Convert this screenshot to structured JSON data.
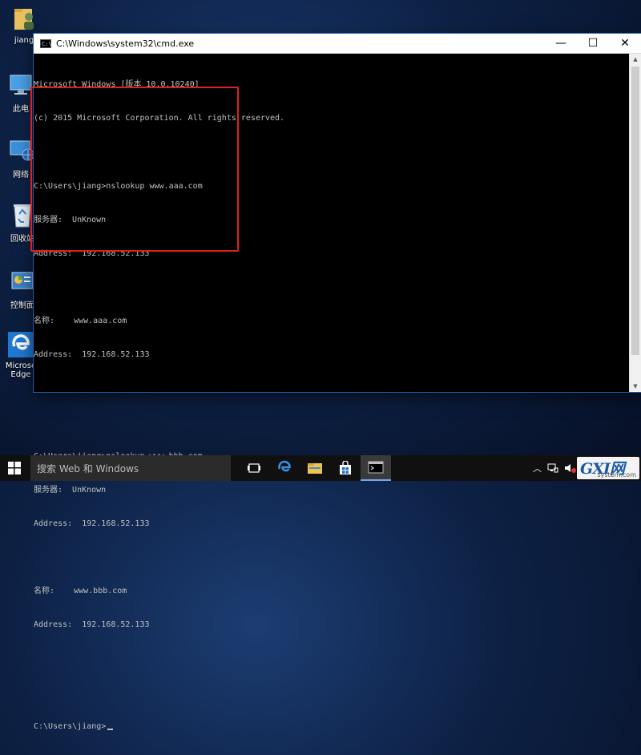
{
  "desktop": {
    "icons": [
      {
        "label": "jiang",
        "icon": "user-folder-icon"
      },
      {
        "label": "此电",
        "icon": "this-pc-icon"
      },
      {
        "label": "网络",
        "icon": "network-icon"
      },
      {
        "label": "回收站",
        "icon": "recycle-bin-icon"
      },
      {
        "label": "控制面",
        "icon": "control-panel-icon"
      },
      {
        "label": "Microso",
        "label2": "Edge",
        "icon": "edge-icon"
      }
    ]
  },
  "window": {
    "title": "C:\\Windows\\system32\\cmd.exe",
    "minimize": "—",
    "maximize": "☐",
    "close": "✕"
  },
  "console": {
    "lines": [
      "Microsoft Windows [版本 10.0.10240]",
      "(c) 2015 Microsoft Corporation. All rights reserved.",
      "",
      "C:\\Users\\jiang>nslookup www.aaa.com",
      "服务器:  UnKnown",
      "Address:  192.168.52.133",
      "",
      "名称:    www.aaa.com",
      "Address:  192.168.52.133",
      "",
      "",
      "C:\\Users\\jiang>nslookup www.bbb.com",
      "服务器:  UnKnown",
      "Address:  192.168.52.133",
      "",
      "名称:    www.bbb.com",
      "Address:  192.168.52.133",
      "",
      "",
      "C:\\Users\\jiang>"
    ]
  },
  "taskbar": {
    "search_placeholder": "搜索 Web 和 Windows",
    "apps": [
      "task-view-icon",
      "edge-icon",
      "file-explorer-icon",
      "store-icon",
      "cmd-icon"
    ]
  },
  "watermark": {
    "brand": "GXI网",
    "site": "system.com"
  },
  "colors": {
    "console_bg": "#000000",
    "console_text": "#c0c0c0",
    "highlight": "#e02020",
    "taskbar": "#101010"
  }
}
